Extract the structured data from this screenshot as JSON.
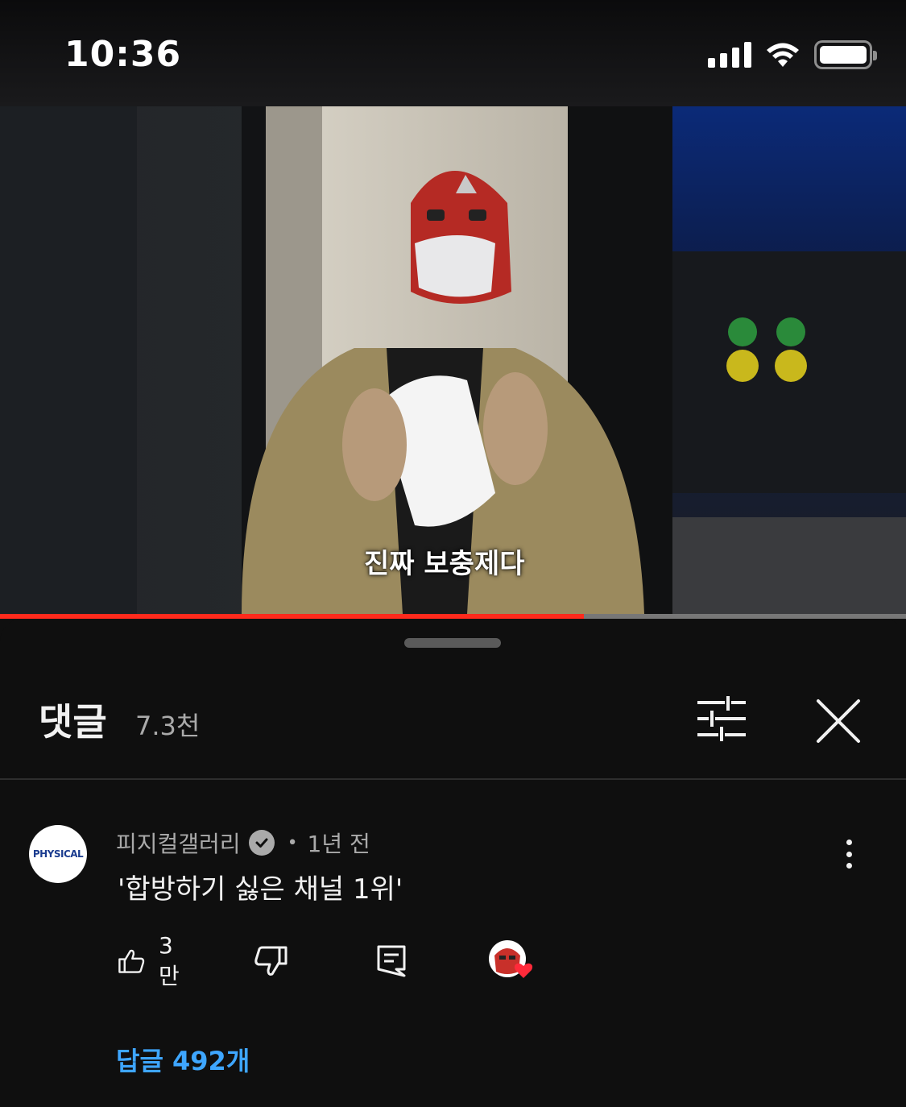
{
  "status_bar": {
    "time": "10:36"
  },
  "video": {
    "subtitle": "진짜 보충제다",
    "progress": 0.644
  },
  "comments_sheet": {
    "title": "댓글",
    "count": "7.3천"
  },
  "comment": {
    "channel_name": "피지컬갤러리",
    "avatar_text": "PHYSICAL",
    "separator": "•",
    "time_ago": "1년 전",
    "text": "'합방하기 싫은 채널 1위'",
    "like_count": "3만",
    "replies_label": "답글 492개"
  },
  "colors": {
    "accent_link": "#3ea6ff",
    "progress_red": "#ff2a1c",
    "background": "#0f0f0f"
  },
  "icons": [
    "signal-icon",
    "wifi-icon",
    "battery-icon",
    "filter-sliders-icon",
    "close-icon",
    "verified-check-icon",
    "more-vert-icon",
    "thumb-up-icon",
    "thumb-down-icon",
    "reply-icon",
    "creator-heart-icon"
  ]
}
